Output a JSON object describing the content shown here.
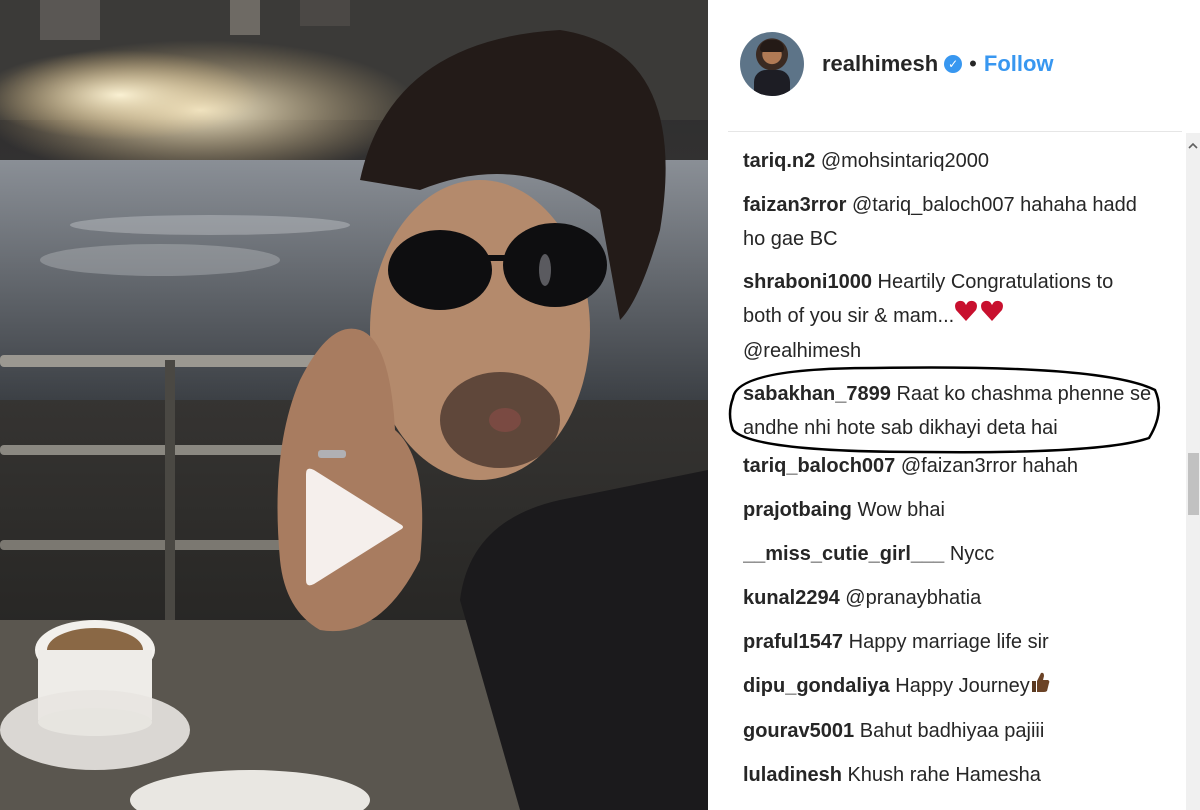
{
  "post": {
    "username": "realhimesh",
    "separator": "•",
    "follow_label": "Follow",
    "verified": true
  },
  "comments": [
    {
      "user": "tariq.n2",
      "text": "",
      "mention": "@mohsintariq2000"
    },
    {
      "user": "faizan3rror",
      "text": "hahaha hadd ho gae BC",
      "mention": "@tariq_baloch007"
    },
    {
      "user": "shraboni1000",
      "text": "Heartily Congratulations to both of you sir & mam...",
      "mention": "@realhimesh"
    },
    {
      "user": "sabakhan_7899",
      "text": "Raat ko chashma phenne se andhe nhi hote sab dikhayi deta hai",
      "mention": ""
    },
    {
      "user": "tariq_baloch007",
      "text": "hahah",
      "mention": "@faizan3rror"
    },
    {
      "user": "prajotbaing",
      "text": "Wow bhai",
      "mention": ""
    },
    {
      "user": "__miss_cutie_girl___",
      "text": "Nycc",
      "mention": ""
    },
    {
      "user": "kunal2294",
      "text": "",
      "mention": "@pranaybhatia"
    },
    {
      "user": "praful1547",
      "text": "Happy marriage life sir",
      "mention": ""
    },
    {
      "user": "dipu_gondaliya",
      "text": "Happy Journey",
      "mention": ""
    },
    {
      "user": "gourav5001",
      "text": "Bahut badhiyaa pajiii",
      "mention": ""
    },
    {
      "user": "luladinesh",
      "text": "Khush rahe Hamesha",
      "mention": ""
    }
  ],
  "colors": {
    "link_blue": "#3897f0",
    "text": "#262626",
    "heart_red": "#c8102e",
    "annotation": "#000000"
  },
  "icons": {
    "play": "play-icon",
    "verified": "verified-badge-icon",
    "heart": "red-heart-icon",
    "thumb": "thumbs-up-icon"
  }
}
